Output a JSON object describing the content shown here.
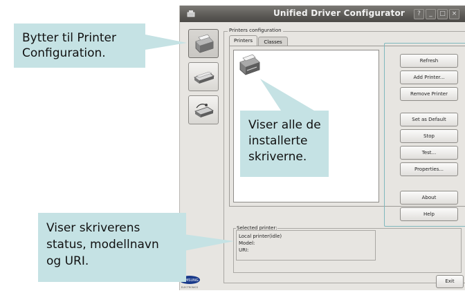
{
  "window": {
    "title": "Unified Driver Configurator",
    "controls": [
      "?",
      "_",
      "□",
      "×"
    ]
  },
  "sidebar": {
    "items": [
      {
        "name": "printer-configuration",
        "icon": "printer-icon",
        "active": true
      },
      {
        "name": "scanner-configuration",
        "icon": "scanner-icon",
        "active": false
      },
      {
        "name": "ports-configuration",
        "icon": "port-icon",
        "active": false
      }
    ]
  },
  "group": {
    "label": "Printers configuration"
  },
  "tabs": [
    {
      "label": "Printers",
      "active": true
    },
    {
      "label": "Classes",
      "active": false
    }
  ],
  "actions": {
    "refresh": "Refresh",
    "add_printer": "Add Printer...",
    "remove_printer": "Remove Printer",
    "set_default": "Set as Default",
    "stop": "Stop",
    "test": "Test...",
    "properties": "Properties...",
    "about": "About",
    "help": "Help"
  },
  "selected": {
    "label": "Selected printer:",
    "status": "Local printer(idle)",
    "model": "Model:",
    "uri": "URI:"
  },
  "footer": {
    "exit": "Exit",
    "brand_text": "SAMSUNG",
    "brand_sub": "ELECTRONICS"
  },
  "callouts": {
    "top_left": [
      "Bytter til Printer",
      "Configuration."
    ],
    "middle": [
      "Viser alle de",
      "installerte",
      "skriverne."
    ],
    "bottom_left": [
      "Viser skriverens",
      "status, modellnavn",
      "og URI."
    ]
  },
  "colors": {
    "callout_bg": "#c5e2e4",
    "titlebar": "#5e5c58",
    "window_bg": "#e7e5e1"
  }
}
